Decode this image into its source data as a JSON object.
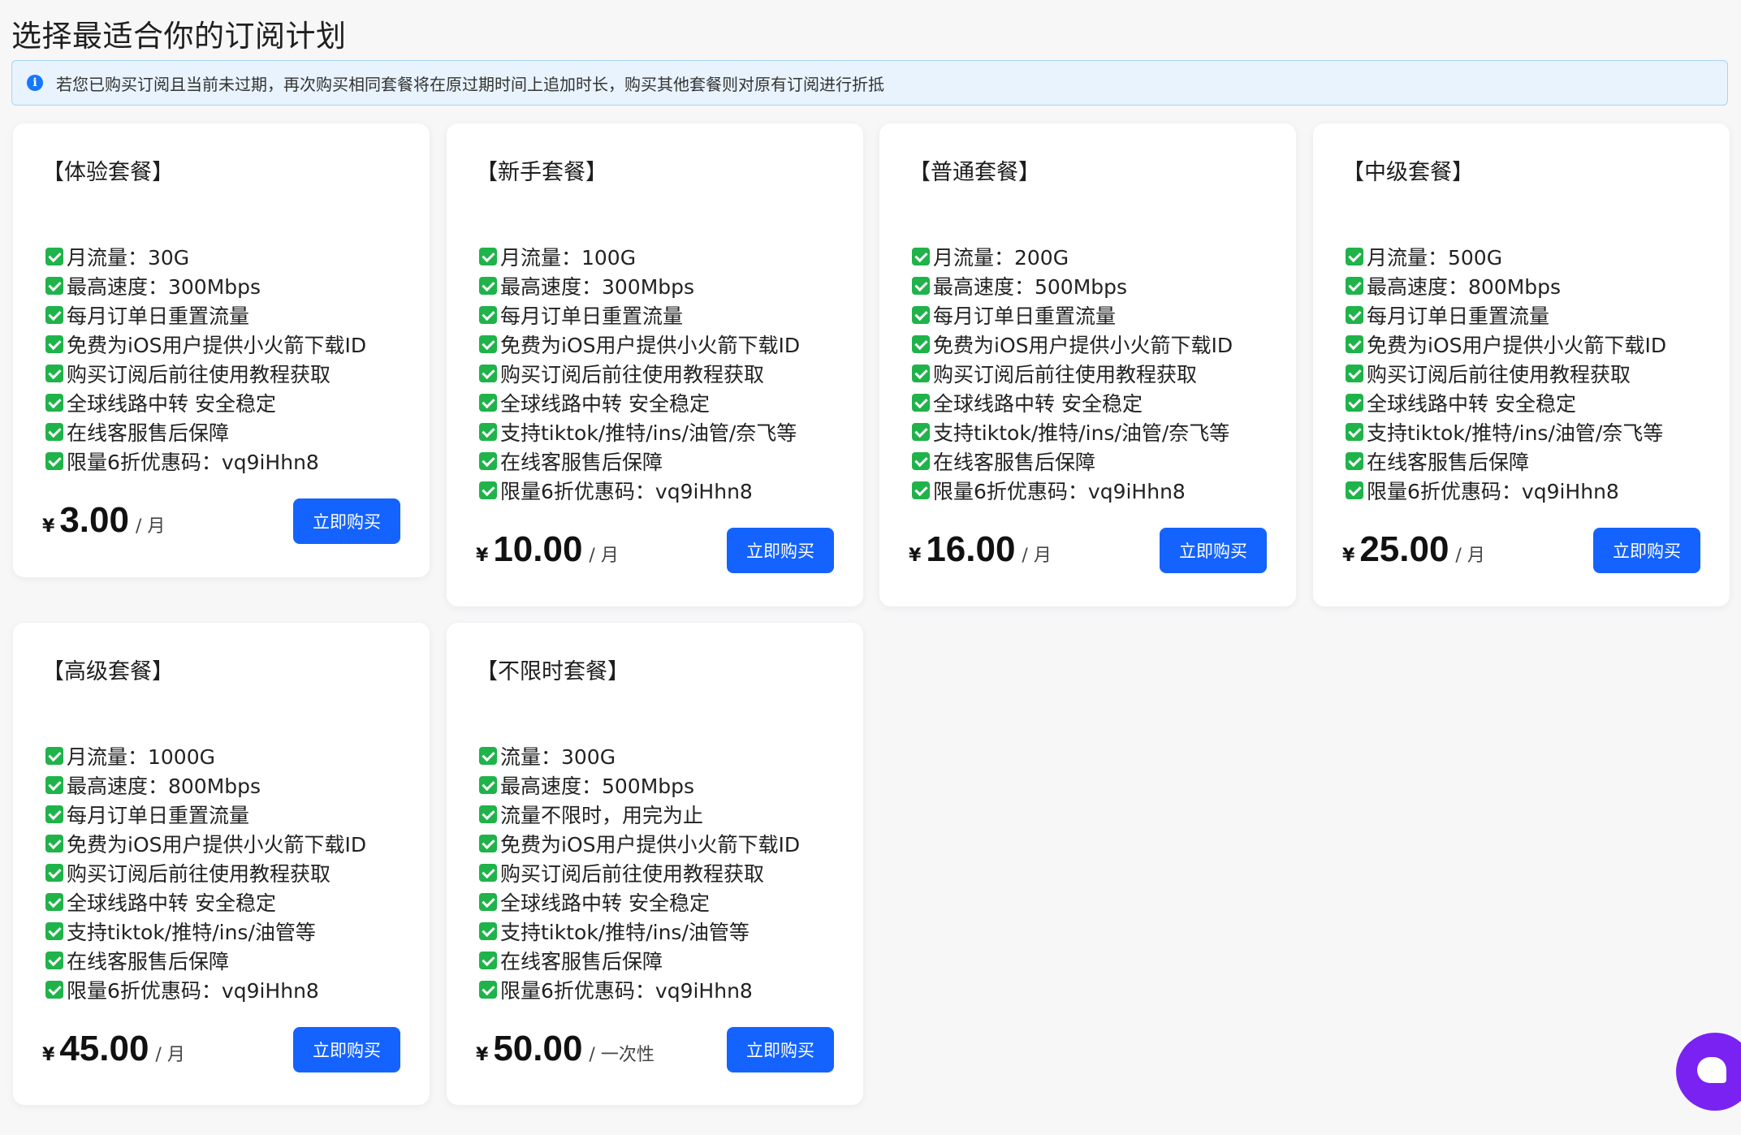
{
  "page": {
    "title": "选择最适合你的订阅计划",
    "notice": "若您已购买订阅且当前未过期，再次购买相同套餐将在原过期时间上追加时长，购买其他套餐则对原有订阅进行折抵"
  },
  "plans": [
    {
      "title": "【体验套餐】",
      "features": [
        "月流量：30G",
        "最高速度：300Mbps",
        "每月订单日重置流量",
        "免费为iOS用户提供小火箭下载ID",
        "购买订阅后前往使用教程获取",
        "全球线路中转 安全稳定",
        "在线客服售后保障",
        "限量6折优惠码：vq9iHhn8"
      ],
      "currency": "¥",
      "price": "3.00",
      "period": "/ 月",
      "button": "立即购买"
    },
    {
      "title": "【新手套餐】",
      "features": [
        "月流量：100G",
        "最高速度：300Mbps",
        "每月订单日重置流量",
        "免费为iOS用户提供小火箭下载ID",
        "购买订阅后前往使用教程获取",
        "全球线路中转 安全稳定",
        "支持tiktok/推特/ins/油管/奈飞等",
        "在线客服售后保障",
        "限量6折优惠码：vq9iHhn8"
      ],
      "currency": "¥",
      "price": "10.00",
      "period": "/ 月",
      "button": "立即购买"
    },
    {
      "title": "【普通套餐】",
      "features": [
        "月流量：200G",
        "最高速度：500Mbps",
        "每月订单日重置流量",
        "免费为iOS用户提供小火箭下载ID",
        "购买订阅后前往使用教程获取",
        "全球线路中转 安全稳定",
        "支持tiktok/推特/ins/油管/奈飞等",
        "在线客服售后保障",
        "限量6折优惠码：vq9iHhn8"
      ],
      "currency": "¥",
      "price": "16.00",
      "period": "/ 月",
      "button": "立即购买"
    },
    {
      "title": "【中级套餐】",
      "features": [
        "月流量：500G",
        "最高速度：800Mbps",
        "每月订单日重置流量",
        "免费为iOS用户提供小火箭下载ID",
        "购买订阅后前往使用教程获取",
        "全球线路中转 安全稳定",
        "支持tiktok/推特/ins/油管/奈飞等",
        "在线客服售后保障",
        "限量6折优惠码：vq9iHhn8"
      ],
      "currency": "¥",
      "price": "25.00",
      "period": "/ 月",
      "button": "立即购买"
    },
    {
      "title": "【高级套餐】",
      "features": [
        "月流量：1000G",
        "最高速度：800Mbps",
        "每月订单日重置流量",
        "免费为iOS用户提供小火箭下载ID",
        "购买订阅后前往使用教程获取",
        "全球线路中转 安全稳定",
        "支持tiktok/推特/ins/油管等",
        "在线客服售后保障",
        "限量6折优惠码：vq9iHhn8"
      ],
      "currency": "¥",
      "price": "45.00",
      "period": "/ 月",
      "button": "立即购买"
    },
    {
      "title": "【不限时套餐】",
      "features": [
        "流量：300G",
        "最高速度：500Mbps",
        "流量不限时，用完为止",
        "免费为iOS用户提供小火箭下载ID",
        "购买订阅后前往使用教程获取",
        "全球线路中转 安全稳定",
        "支持tiktok/推特/ins/油管等",
        "在线客服售后保障",
        "限量6折优惠码：vq9iHhn8"
      ],
      "currency": "¥",
      "price": "50.00",
      "period": "/ 一次性",
      "button": "立即购买"
    }
  ],
  "colors": {
    "accent": "#1463ff",
    "check": "#1fb34a",
    "chat": "#7a22f2"
  },
  "chat": {
    "icon": "chat-icon"
  }
}
